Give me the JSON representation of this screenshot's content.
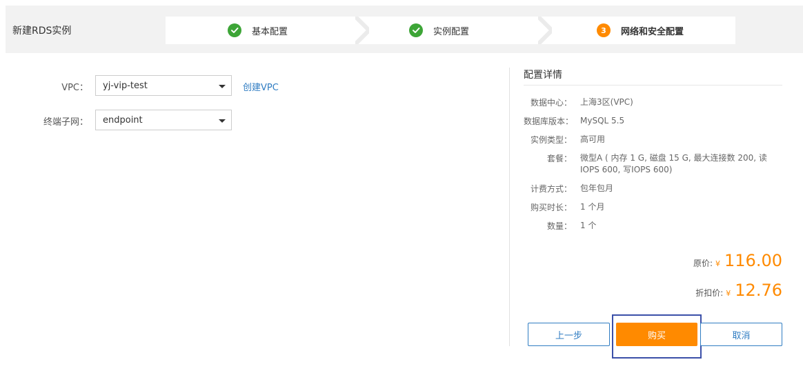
{
  "header": {
    "title": "新建RDS实例",
    "steps": [
      {
        "label": "基本配置",
        "status": "done"
      },
      {
        "label": "实例配置",
        "status": "done"
      },
      {
        "label": "网络和安全配置",
        "status": "current",
        "index": "3"
      }
    ]
  },
  "form": {
    "vpc_label": "VPC：",
    "vpc_value": "yj-vip-test",
    "create_vpc_link": "创建VPC",
    "subnet_label": "终端子网：",
    "subnet_value": "endpoint"
  },
  "details": {
    "title": "配置详情",
    "rows": [
      {
        "key": "数据中心：",
        "value": "上海3区(VPC)"
      },
      {
        "key": "数据库版本：",
        "value": "MySQL 5.5"
      },
      {
        "key": "实例类型：",
        "value": "高可用"
      },
      {
        "key": "套餐：",
        "value": "微型A ( 内存 1 G, 磁盘 15 G, 最大连接数 200, 读IOPS 600, 写IOPS 600)"
      },
      {
        "key": "计费方式：",
        "value": "包年包月"
      },
      {
        "key": "购买时长：",
        "value": "1 个月"
      },
      {
        "key": "数量：",
        "value": "1 个"
      }
    ],
    "original_price_label": "原价:",
    "original_price_currency": "¥",
    "original_price": "116.00",
    "discount_price_label": "折扣价:",
    "discount_price_currency": "¥",
    "discount_price": "12.76"
  },
  "buttons": {
    "prev": "上一步",
    "buy": "购买",
    "cancel": "取消"
  },
  "colors": {
    "accent": "#ff8a00",
    "link": "#2f7cc2",
    "success": "#3da537"
  }
}
